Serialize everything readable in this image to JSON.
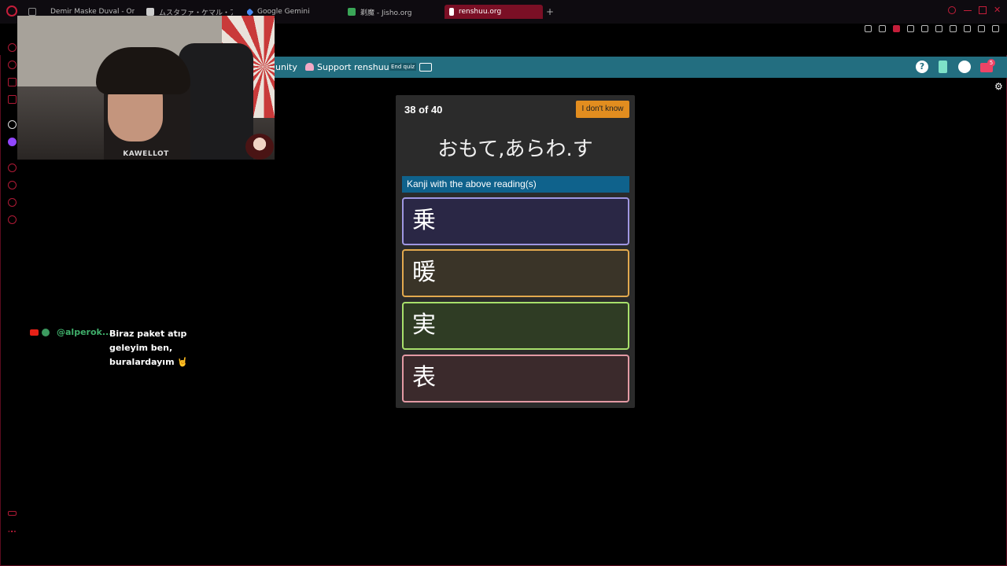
{
  "browser": {
    "tabs": [
      {
        "label": "Demir Maske Duval - One",
        "icon_color": "#888888"
      },
      {
        "label": "ムスタファ・ケマル・アタテュルク",
        "icon_color": "#cccccc"
      },
      {
        "label": "Google Gemini",
        "icon_color": "#4a8af4"
      },
      {
        "label": "剃魔 - Jisho.org",
        "icon_color": "#3aa657"
      },
      {
        "label": "renshuu.org",
        "icon_color": "#ffffff"
      }
    ],
    "new_tab_label": "+",
    "accent": "#c41e3a"
  },
  "site_nav": {
    "community_label": "unity",
    "support_label": "Support renshuu",
    "end_quiz_label": "End quiz",
    "help_label": "?",
    "mail_badge": "5"
  },
  "webcam": {
    "name_label": "KAWELLOT"
  },
  "chat": {
    "username": "@alperok...",
    "message": "Biraz paket atıp geleyim ben, buralardayım 🤘"
  },
  "quiz": {
    "counter": "38 of 40",
    "dont_know_label": "I don't know",
    "reading": "おもて,あらわ.す",
    "prompt": "Kanji with the above reading(s)",
    "choices": [
      "乗",
      "暖",
      "実",
      "表"
    ]
  },
  "colors": {
    "nav_bg": "#236e80",
    "prompt_bg": "#0f628c",
    "dont_know_bg": "#e28d1f"
  }
}
